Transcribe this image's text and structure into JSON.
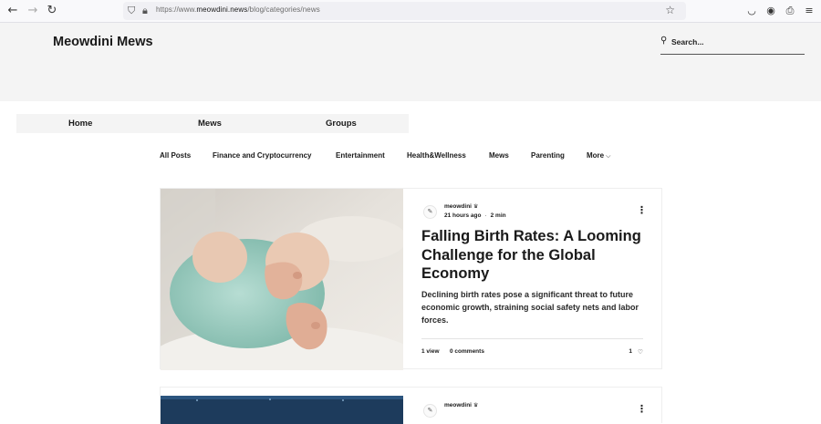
{
  "browser": {
    "url_prefix": "https://www.",
    "url_host": "meowdini.news",
    "url_path": "/blog/categories/news"
  },
  "site": {
    "title": "Meowdini Mews",
    "search_placeholder": "Search..."
  },
  "main_nav": [
    "Home",
    "Mews",
    "Groups"
  ],
  "categories": [
    "All Posts",
    "Finance and Cryptocurrency",
    "Entertainment",
    "Health&Wellness",
    "Mews",
    "Parenting",
    "More"
  ],
  "posts": [
    {
      "author": "meowdini",
      "time": "21 hours ago",
      "read_time": "2 min",
      "title": "Falling Birth Rates: A Looming Challenge for the Global Economy",
      "excerpt": "Declining birth rates pose a significant threat to future economic growth, straining social safety nets and labor forces.",
      "views": "1 view",
      "comments": "0 comments",
      "likes": "1"
    },
    {
      "author": "meowdini"
    }
  ],
  "colors": {
    "header_bg": "#f4f4f4",
    "heart": "#d03b3b"
  }
}
